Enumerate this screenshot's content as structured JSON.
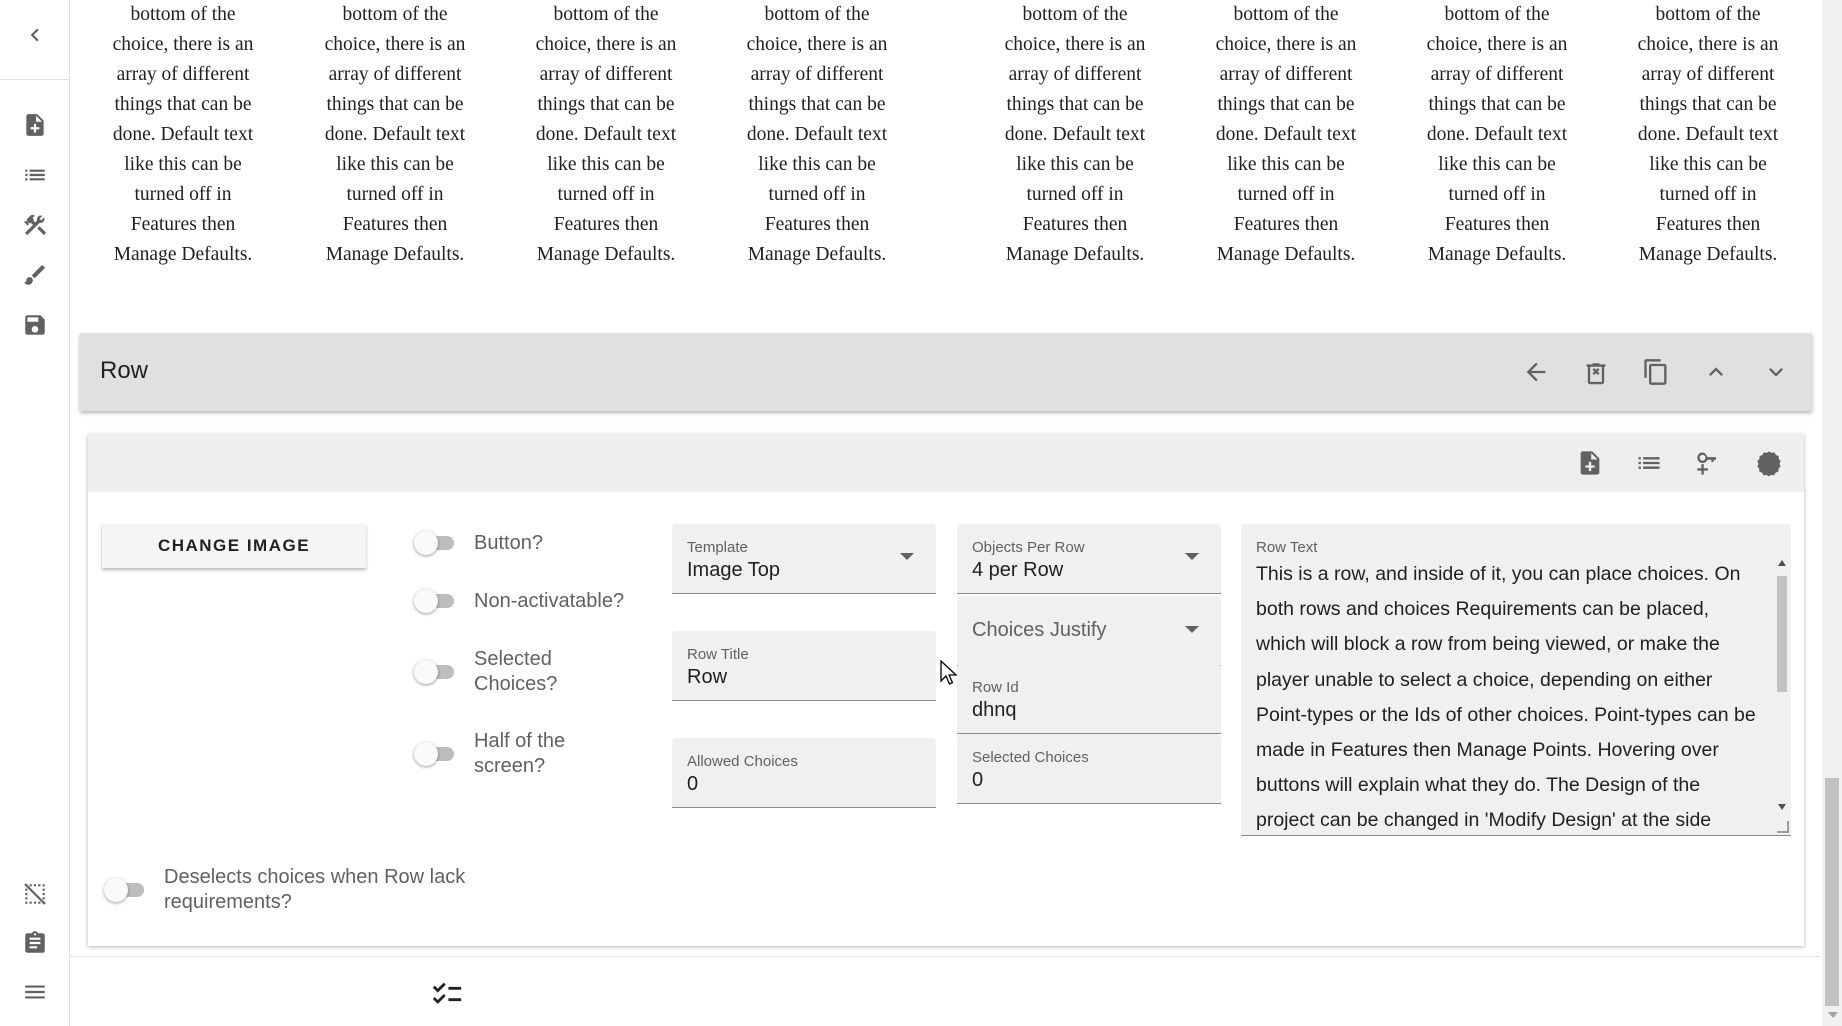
{
  "choice_texts": [
    {
      "lines": [
        "bottom of the",
        "choice, there is an",
        "array of different",
        "things that can be",
        "done. Default text",
        "like this can be",
        "turned off in",
        "Features then",
        "Manage Defaults."
      ]
    },
    {
      "lines": [
        "bottom of the",
        "choice, there is an",
        "array of different",
        "things that can be",
        "done. Default text",
        "like this can be",
        "turned off in",
        "Features then",
        "Manage Defaults."
      ]
    },
    {
      "lines": [
        "bottom of the",
        "choice, there is an",
        "array of different",
        "things that can be",
        "done. Default text",
        "like this can be",
        "turned off in",
        "Features then",
        "Manage Defaults."
      ]
    },
    {
      "lines": [
        "bottom of the",
        "choice, there is an",
        "array of different",
        "things that can be",
        "done. Default text",
        "like this can be",
        "turned off in",
        "Features then",
        "Manage Defaults."
      ]
    },
    {
      "lines": [
        "bottom of the",
        "choice, there is an",
        "array of different",
        "things that can be",
        "done. Default text",
        "like this can be",
        "turned off in",
        "Features then",
        "Manage Defaults."
      ]
    },
    {
      "lines": [
        "bottom of the",
        "choice, there is an",
        "array of different",
        "things that can be",
        "done. Default text",
        "like this can be",
        "turned off in",
        "Features then",
        "Manage Defaults."
      ]
    },
    {
      "lines": [
        "bottom of the",
        "choice, there is an",
        "array of different",
        "things that can be",
        "done. Default text",
        "like this can be",
        "turned off in",
        "Features then",
        "Manage Defaults."
      ]
    },
    {
      "lines": [
        "bottom of the",
        "choice, there is an",
        "array of different",
        "things that can be",
        "done. Default text",
        "like this can be",
        "turned off in",
        "Features then",
        "Manage Defaults."
      ]
    }
  ],
  "rail": {
    "icons": [
      "chevron-left-icon",
      "note-add-icon",
      "list-icon",
      "tools-icon",
      "brush-icon",
      "save-icon",
      "hide-image-icon",
      "clipboard-icon",
      "menu-icon"
    ]
  },
  "row_bar": {
    "title": "Row",
    "icons": [
      "arrow-back-icon",
      "delete-icon",
      "copy-icon",
      "chevron-up-icon",
      "chevron-down-icon"
    ]
  },
  "card": {
    "toolbar_icons": [
      "note-add-icon",
      "list-icon",
      "key-plus-icon",
      "cog-icon"
    ],
    "change_image_label": "CHANGE IMAGE",
    "switches": {
      "button": "Button?",
      "non_activatable": "Non-activatable?",
      "selected_choices_1": "Selected",
      "selected_choices_2": "Choices?",
      "half_screen_1": "Half of the",
      "half_screen_2": "screen?",
      "deselect_1": "Deselects choices when Row lack",
      "deselect_2": "requirements?"
    },
    "template": {
      "label": "Template",
      "value": "Image Top"
    },
    "row_title": {
      "label": "Row Title",
      "value": "Row"
    },
    "allowed_choices": {
      "label": "Allowed Choices",
      "value": "0"
    },
    "objects_per_row": {
      "label": "Objects Per Row",
      "value": "4 per Row"
    },
    "choices_justify": {
      "placeholder": "Choices Justify"
    },
    "row_id": {
      "label": "Row Id",
      "value": "dhnq"
    },
    "selected_choices": {
      "label": "Selected Choices",
      "value": "0"
    },
    "row_text": {
      "label": "Row Text",
      "value": "This is a row, and inside of it, you can place choices. On both rows and choices Requirements can be placed, which will block a row from being viewed, or make the player unable to select a choice, depending on either Point-types or the Ids of other choices. Point-types can be made in Features then Manage Points. Hovering over buttons will explain what they do. The Design of the project can be changed in 'Modify Design' at the side"
    }
  },
  "bottom_icon": "checklist-icon"
}
